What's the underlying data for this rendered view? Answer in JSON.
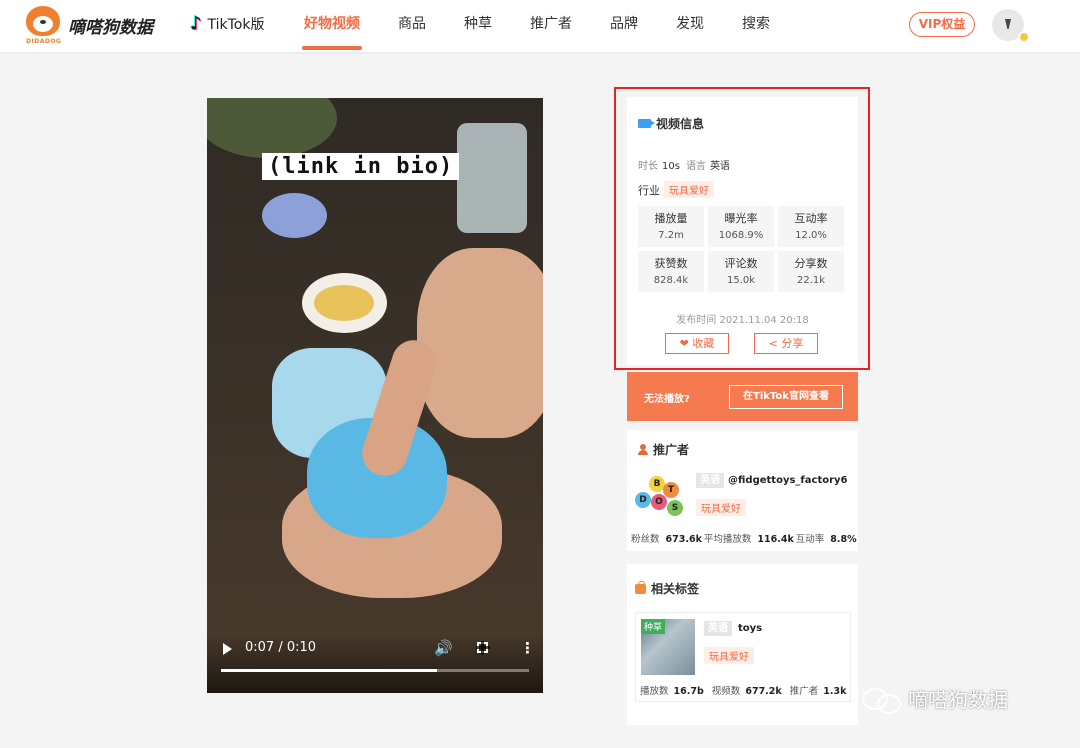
{
  "header": {
    "brand": "嘀嗒狗数据",
    "logo_text": "DIDADOG",
    "tiktok_label": "TikTok版",
    "nav": [
      "好物视频",
      "商品",
      "种草",
      "推广者",
      "品牌",
      "发现",
      "搜索"
    ],
    "active_nav": "好物视频",
    "vip_label": "VIP权益"
  },
  "video": {
    "caption": "(link in bio)",
    "time": "0:07 / 0:10",
    "progress": 0.7
  },
  "video_info": {
    "title": "视频信息",
    "duration_label": "时长",
    "duration": "10s",
    "language_label": "语言",
    "language": "英语",
    "industry_label": "行业",
    "industry": "玩具爱好",
    "stats": [
      {
        "label": "播放量",
        "value": "7.2m"
      },
      {
        "label": "曝光率",
        "value": "1068.9%"
      },
      {
        "label": "互动率",
        "value": "12.0%"
      },
      {
        "label": "获赞数",
        "value": "828.4k"
      },
      {
        "label": "评论数",
        "value": "15.0k"
      },
      {
        "label": "分享数",
        "value": "22.1k"
      }
    ],
    "publish_time": "发布时间 2021.11.04 20:18",
    "favorite_label": "❤ 收藏",
    "share_label": "分享"
  },
  "cta": {
    "text": "无法播放?",
    "button": "在TikTok官网查看"
  },
  "promoter": {
    "title": "推广者",
    "language": "英语",
    "handle": "@fidgettoys_factory6",
    "industry": "玩具爱好",
    "avatar_letters": [
      "B",
      "T",
      "D",
      "O",
      "S"
    ],
    "fans_label": "粉丝数",
    "fans": "673.6k",
    "avg_play_label": "平均播放数",
    "avg_play": "116.4k",
    "engagement_label": "互动率",
    "engagement": "8.8%"
  },
  "related_tags": {
    "title": "相关标签",
    "thumb_label": "种草",
    "language": "英语",
    "tag": "toys",
    "industry": "玩具爱好",
    "plays_label": "播放数",
    "plays": "16.7b",
    "videos_label": "视频数",
    "videos": "677.2k",
    "promoters_label": "推广者",
    "promoters": "1.3k"
  },
  "watermark": "嘀嗒狗数据"
}
